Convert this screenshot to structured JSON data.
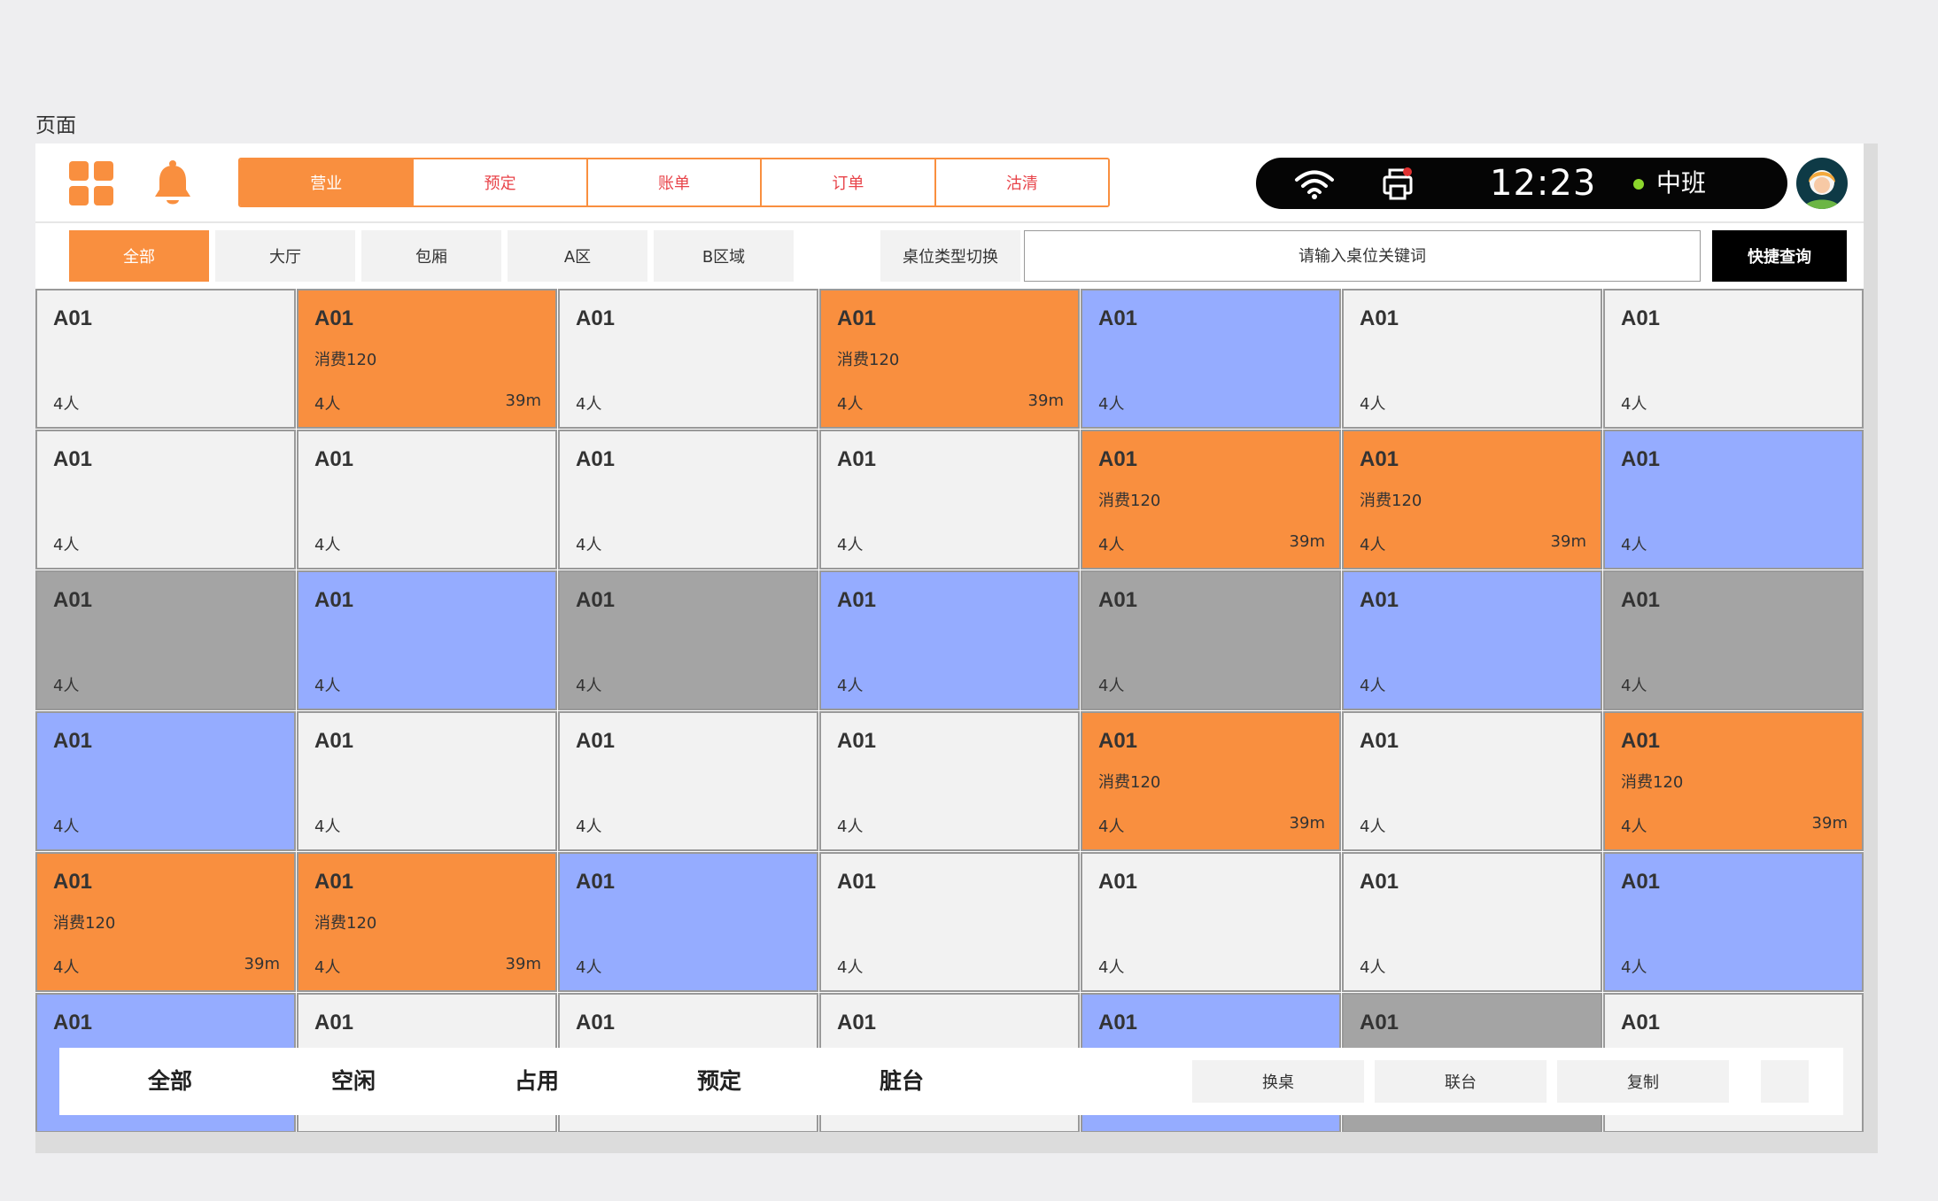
{
  "page": {
    "label": "页面"
  },
  "header": {
    "tabs": [
      {
        "label": "营业",
        "active": true
      },
      {
        "label": "预定",
        "active": false
      },
      {
        "label": "账单",
        "active": false
      },
      {
        "label": "订单",
        "active": false
      },
      {
        "label": "沽清",
        "active": false
      }
    ],
    "status": {
      "time": "12:23",
      "shift": "中班"
    },
    "icons": [
      "apps-grid-icon",
      "bell-icon",
      "wifi-icon",
      "printer-icon",
      "avatar"
    ],
    "colors": {
      "accent": "#f98f3f",
      "tab_text": "#e8444a",
      "shift_dot": "#8cd62c",
      "notification_dot": "#e03131"
    }
  },
  "filters": {
    "areas": [
      {
        "label": "全部",
        "active": true
      },
      {
        "label": "大厅",
        "active": false
      },
      {
        "label": "包厢",
        "active": false
      },
      {
        "label": "A区",
        "active": false
      },
      {
        "label": "B区域",
        "active": false
      }
    ],
    "type_switch_label": "桌位类型切换",
    "search_placeholder": "请输入桌位关键词",
    "search_button_label": "快捷查询"
  },
  "status_colors": {
    "idle": "#f2f2f2",
    "occupied": "#f98f3f",
    "reserved": "#95acff",
    "dirty": "#a4a4a4"
  },
  "tables": [
    [
      {
        "name": "A01",
        "status": "idle",
        "seats": "4人"
      },
      {
        "name": "A01",
        "status": "occupied",
        "spend": "消费120",
        "seats": "4人",
        "time": "39m"
      },
      {
        "name": "A01",
        "status": "idle",
        "seats": "4人"
      },
      {
        "name": "A01",
        "status": "occupied",
        "spend": "消费120",
        "seats": "4人",
        "time": "39m"
      },
      {
        "name": "A01",
        "status": "reserved",
        "seats": "4人"
      },
      {
        "name": "A01",
        "status": "idle",
        "seats": "4人"
      },
      {
        "name": "A01",
        "status": "idle",
        "seats": "4人"
      }
    ],
    [
      {
        "name": "A01",
        "status": "idle",
        "seats": "4人"
      },
      {
        "name": "A01",
        "status": "idle",
        "seats": "4人"
      },
      {
        "name": "A01",
        "status": "idle",
        "seats": "4人"
      },
      {
        "name": "A01",
        "status": "idle",
        "seats": "4人"
      },
      {
        "name": "A01",
        "status": "occupied",
        "spend": "消费120",
        "seats": "4人",
        "time": "39m"
      },
      {
        "name": "A01",
        "status": "occupied",
        "spend": "消费120",
        "seats": "4人",
        "time": "39m"
      },
      {
        "name": "A01",
        "status": "reserved",
        "seats": "4人"
      }
    ],
    [
      {
        "name": "A01",
        "status": "dirty",
        "seats": "4人"
      },
      {
        "name": "A01",
        "status": "reserved",
        "seats": "4人"
      },
      {
        "name": "A01",
        "status": "dirty",
        "seats": "4人"
      },
      {
        "name": "A01",
        "status": "reserved",
        "seats": "4人"
      },
      {
        "name": "A01",
        "status": "dirty",
        "seats": "4人"
      },
      {
        "name": "A01",
        "status": "reserved",
        "seats": "4人"
      },
      {
        "name": "A01",
        "status": "dirty",
        "seats": "4人"
      }
    ],
    [
      {
        "name": "A01",
        "status": "reserved",
        "seats": "4人"
      },
      {
        "name": "A01",
        "status": "idle",
        "seats": "4人"
      },
      {
        "name": "A01",
        "status": "idle",
        "seats": "4人"
      },
      {
        "name": "A01",
        "status": "idle",
        "seats": "4人"
      },
      {
        "name": "A01",
        "status": "occupied",
        "spend": "消费120",
        "seats": "4人",
        "time": "39m"
      },
      {
        "name": "A01",
        "status": "idle",
        "seats": "4人"
      },
      {
        "name": "A01",
        "status": "occupied",
        "spend": "消费120",
        "seats": "4人",
        "time": "39m"
      }
    ],
    [
      {
        "name": "A01",
        "status": "occupied",
        "spend": "消费120",
        "seats": "4人",
        "time": "39m"
      },
      {
        "name": "A01",
        "status": "occupied",
        "spend": "消费120",
        "seats": "4人",
        "time": "39m"
      },
      {
        "name": "A01",
        "status": "reserved",
        "seats": "4人"
      },
      {
        "name": "A01",
        "status": "idle",
        "seats": "4人"
      },
      {
        "name": "A01",
        "status": "idle",
        "seats": "4人"
      },
      {
        "name": "A01",
        "status": "idle",
        "seats": "4人"
      },
      {
        "name": "A01",
        "status": "reserved",
        "seats": "4人"
      }
    ],
    [
      {
        "name": "A01",
        "status": "reserved"
      },
      {
        "name": "A01",
        "status": "idle"
      },
      {
        "name": "A01",
        "status": "idle"
      },
      {
        "name": "A01",
        "status": "idle"
      },
      {
        "name": "A01",
        "status": "reserved"
      },
      {
        "name": "A01",
        "status": "dirty"
      },
      {
        "name": "A01",
        "status": "idle"
      }
    ]
  ],
  "bottom_bar": {
    "status_filters": [
      "全部",
      "空闲",
      "占用",
      "预定",
      "脏台"
    ],
    "actions": [
      "换桌",
      "联台",
      "复制"
    ]
  }
}
